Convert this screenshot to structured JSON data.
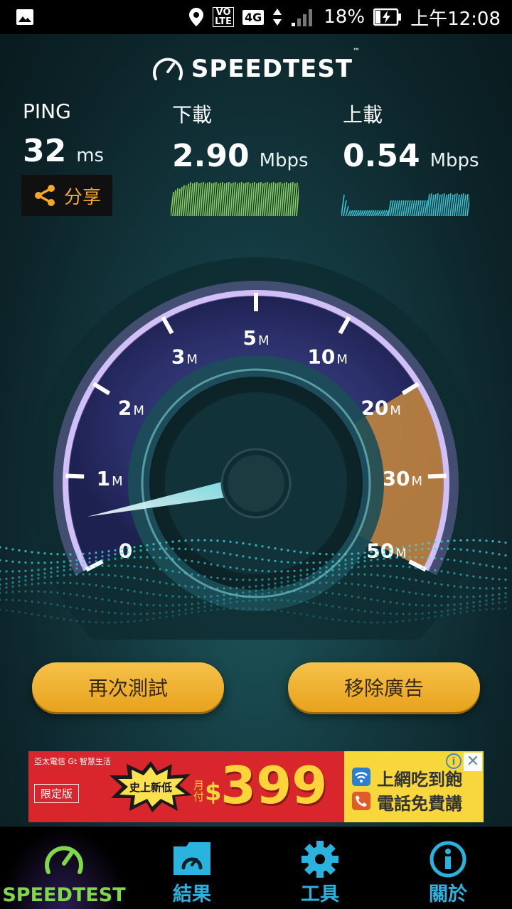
{
  "status_bar": {
    "battery": "18%",
    "time": "上午12:08",
    "network": "4G",
    "volte": "VO\nLTE"
  },
  "header": {
    "title": "SPEEDTEST",
    "trademark": "™"
  },
  "stats": {
    "ping": {
      "label": "PING",
      "value": "32",
      "unit": "ms"
    },
    "download": {
      "label": "下載",
      "value": "2.90",
      "unit": "Mbps"
    },
    "upload": {
      "label": "上載",
      "value": "0.54",
      "unit": "Mbps"
    }
  },
  "share": {
    "label": "分享"
  },
  "gauge": {
    "ticks": [
      {
        "num": "0",
        "unit": ""
      },
      {
        "num": "1",
        "unit": "M"
      },
      {
        "num": "2",
        "unit": "M"
      },
      {
        "num": "3",
        "unit": "M"
      },
      {
        "num": "5",
        "unit": "M"
      },
      {
        "num": "10",
        "unit": "M"
      },
      {
        "num": "20",
        "unit": "M"
      },
      {
        "num": "30",
        "unit": "M"
      },
      {
        "num": "50",
        "unit": "M"
      }
    ],
    "needle_value": 0.54,
    "accent_color": "#c98a3c",
    "ring_color": "#b59ae8"
  },
  "buttons": {
    "retest": "再次測試",
    "remove_ads": "移除廣告"
  },
  "ad": {
    "brand": "亞太電信 Gt 智慧生活",
    "tag": "限定版",
    "burst": "史上新低",
    "monthly": "月付",
    "currency": "$",
    "price": "399",
    "line1": "上網吃到飽",
    "line2": "電話免費講",
    "close": "✕",
    "info": "i"
  },
  "nav": {
    "items": [
      {
        "label": "SPEEDTEST",
        "icon": "gauge-icon",
        "color": "#7ed84a"
      },
      {
        "label": "結果",
        "icon": "folder-gauge-icon",
        "color": "#2bb3e0"
      },
      {
        "label": "工具",
        "icon": "gear-icon",
        "color": "#2bb3e0"
      },
      {
        "label": "關於",
        "icon": "info-icon",
        "color": "#2bb3e0"
      }
    ]
  }
}
